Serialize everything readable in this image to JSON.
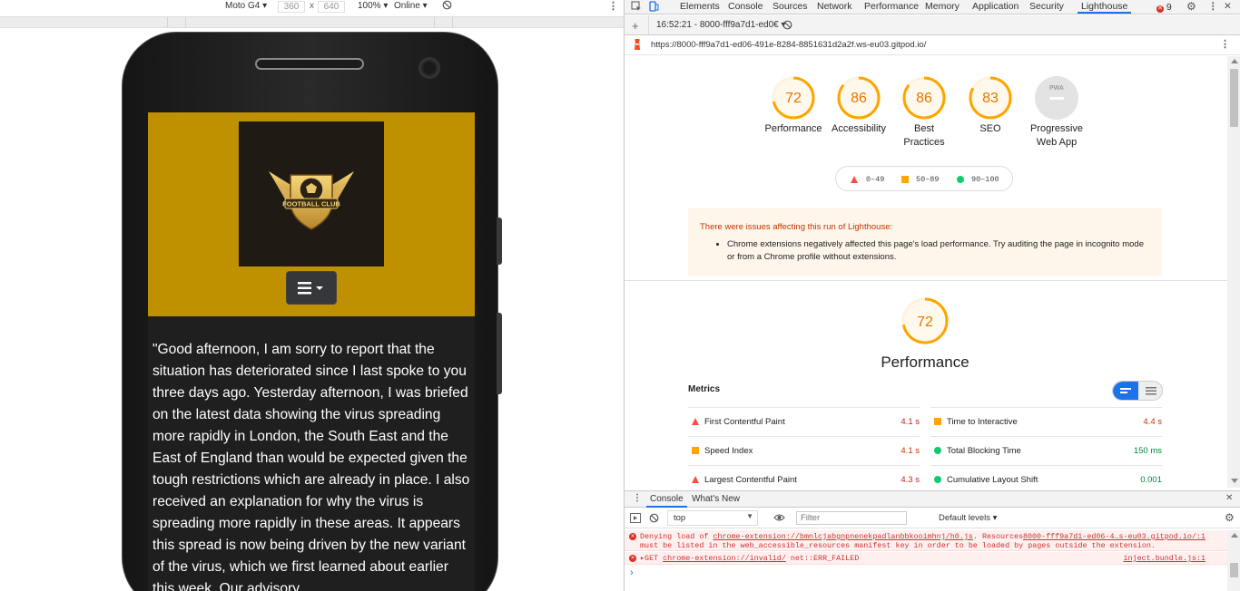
{
  "device_toolbar": {
    "device": "Moto G4 ▾",
    "width": "360",
    "times": "x",
    "height": "640",
    "zoom": "100% ▾",
    "network": "Online ▾"
  },
  "site": {
    "logo_text": "FOOTBALL CLUB",
    "paragraph": "\"Good afternoon, I am sorry to report that the situation has deteriorated since I last spoke to you three days ago. Yesterday afternoon, I was briefed on the latest data showing the virus spreading more rapidly in London, the South East and the East of England than would be expected given the tough restrictions which are already in place. I also received an explanation for why the virus is spreading more rapidly in these areas. It appears this spread is now being driven by the new variant of the virus, which we first learned about earlier this week. Our advisory"
  },
  "devtools": {
    "tabs": [
      "Elements",
      "Console",
      "Sources",
      "Network",
      "Performance",
      "Memory",
      "Application",
      "Security",
      "Lighthouse"
    ],
    "active_tab": "Lighthouse",
    "error_count": "9",
    "report_selector": "16:52:21 - 8000-fff9a7d1-ed0€ ▾",
    "url": "https://8000-fff9a7d1-ed06-491e-8284-8851631d2a2f.ws-eu03.gitpod.io/"
  },
  "scores": [
    {
      "value": "72",
      "label1": "Performance",
      "label2": "",
      "fraction": 0.72
    },
    {
      "value": "86",
      "label1": "Accessibility",
      "label2": "",
      "fraction": 0.86
    },
    {
      "value": "86",
      "label1": "Best",
      "label2": "Practices",
      "fraction": 0.86
    },
    {
      "value": "83",
      "label1": "SEO",
      "label2": "",
      "fraction": 0.83
    },
    {
      "value": "",
      "label1": "Progressive",
      "label2": "Web App",
      "fraction": 0,
      "badge": "PWA"
    }
  ],
  "legend": {
    "fail": "0–49",
    "average": "50–89",
    "pass": "90–100"
  },
  "warning": {
    "title": "There were issues affecting this run of Lighthouse:",
    "item": "Chrome extensions negatively affected this page's load performance. Try auditing the page in incognito mode or from a Chrome profile without extensions."
  },
  "performance": {
    "score": "72",
    "fraction": 0.72,
    "title": "Performance",
    "metrics_heading": "Metrics",
    "metrics": [
      {
        "name": "First Contentful Paint",
        "value": "4.1 s",
        "status": "fail",
        "color": "#c7221f"
      },
      {
        "name": "Time to Interactive",
        "value": "4.4 s",
        "status": "average",
        "color": "#c33300"
      },
      {
        "name": "Speed Index",
        "value": "4.1 s",
        "status": "average",
        "color": "#c33300"
      },
      {
        "name": "Total Blocking Time",
        "value": "150 ms",
        "status": "pass",
        "color": "#018642"
      },
      {
        "name": "Largest Contentful Paint",
        "value": "4.3 s",
        "status": "fail",
        "color": "#c7221f"
      },
      {
        "name": "Cumulative Layout Shift",
        "value": "0.001",
        "status": "pass",
        "color": "#018642"
      }
    ]
  },
  "drawer": {
    "tabs": [
      "Console",
      "What's New"
    ],
    "context": "top",
    "filter_placeholder": "Filter",
    "levels": "Default levels ▾",
    "messages": [
      {
        "line1_pre": "Denying load of ",
        "line1_link": "chrome-extension://bmnlcjabgnpnenekpadlanbbkooimhnj/h0.js",
        "line1_post": ". Resources",
        "source": "8000-fff9a7d1-ed06-4…s-eu03.gitpod.io/:1",
        "line2": "must be listed in the web_accessible_resources manifest key in order to be loaded by pages outside the extension."
      },
      {
        "line1_pre": "▸GET ",
        "line1_link": "chrome-extension://invalid/",
        "line1_post": " net::ERR_FAILED",
        "source": "inject.bundle.js:1",
        "line2": ""
      }
    ],
    "prompt": "›"
  },
  "colors": {
    "fail": "#ff4e42",
    "average": "#ffa400",
    "pass": "#0cce6b",
    "gauge_average": "#ffa400",
    "header_gold": "#bf9000",
    "active_tab": "#1a73e8"
  }
}
